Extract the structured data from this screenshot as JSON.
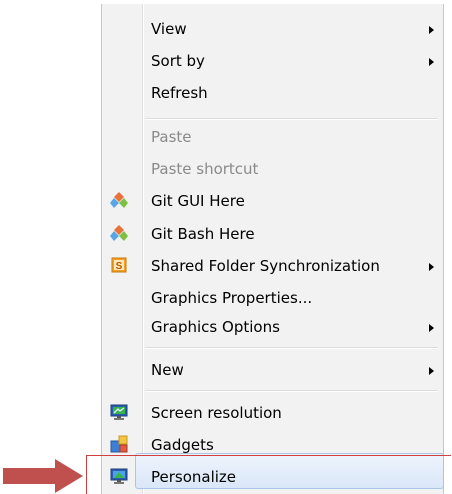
{
  "menu": {
    "items": [
      {
        "label": "View",
        "submenu": true,
        "disabled": false,
        "icon": null
      },
      {
        "label": "Sort by",
        "submenu": true,
        "disabled": false,
        "icon": null
      },
      {
        "label": "Refresh",
        "submenu": false,
        "disabled": false,
        "icon": null
      },
      {
        "label": "Paste",
        "submenu": false,
        "disabled": true,
        "icon": null
      },
      {
        "label": "Paste shortcut",
        "submenu": false,
        "disabled": true,
        "icon": null
      },
      {
        "label": "Git GUI Here",
        "submenu": false,
        "disabled": false,
        "icon": "git-icon"
      },
      {
        "label": "Git Bash Here",
        "submenu": false,
        "disabled": false,
        "icon": "git-icon"
      },
      {
        "label": "Shared Folder Synchronization",
        "submenu": true,
        "disabled": false,
        "icon": "shared-folder-sync-icon"
      },
      {
        "label": "Graphics Properties...",
        "submenu": false,
        "disabled": false,
        "icon": null
      },
      {
        "label": "Graphics Options",
        "submenu": true,
        "disabled": false,
        "icon": null
      },
      {
        "label": "New",
        "submenu": true,
        "disabled": false,
        "icon": null
      },
      {
        "label": "Screen resolution",
        "submenu": false,
        "disabled": false,
        "icon": "screen-resolution-icon"
      },
      {
        "label": "Gadgets",
        "submenu": false,
        "disabled": false,
        "icon": "gadgets-icon"
      },
      {
        "label": "Personalize",
        "submenu": false,
        "disabled": false,
        "icon": "personalize-icon",
        "highlighted": true
      }
    ],
    "shared_folder_icon_letter": "S"
  },
  "colors": {
    "menu_background": "#f2f2f2",
    "highlight_border": "#a9c6e8",
    "annotation_red": "#c0504d"
  }
}
